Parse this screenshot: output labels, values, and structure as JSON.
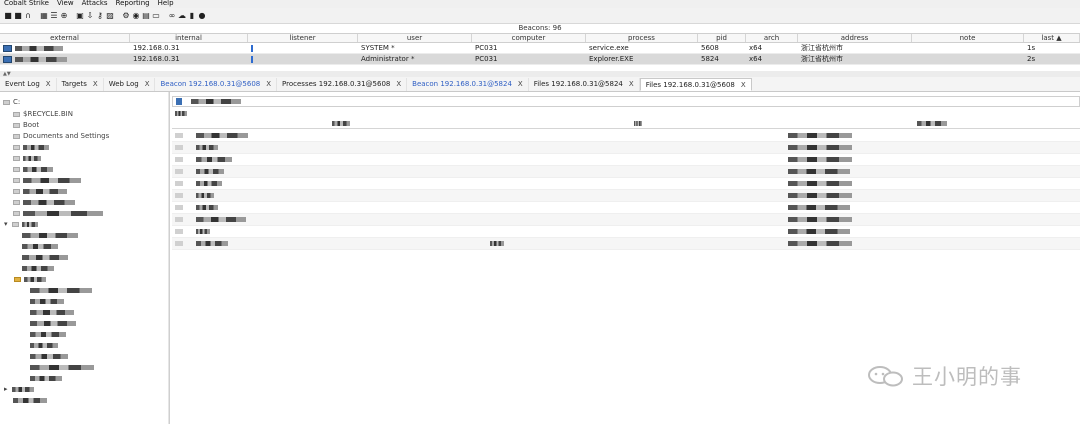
{
  "menu": [
    "Cobalt Strike",
    "View",
    "Attacks",
    "Reporting",
    "Help"
  ],
  "toolbar_icons": [
    "connect-icon",
    "disconnect-icon",
    "headset-icon",
    "listeners-icon",
    "sessions-icon",
    "target-icon",
    "credentials-icon",
    "download-icon",
    "key-icon",
    "image-icon",
    "gear-icon",
    "coffee-icon",
    "document-icon",
    "terminal-icon",
    "link-icon",
    "cloud-icon",
    "book-icon",
    "cube-icon"
  ],
  "beacon_panel": {
    "title": "Beacons: 96",
    "columns": [
      "external",
      "internal",
      "listener",
      "user",
      "computer",
      "process",
      "pid",
      "arch",
      "address",
      "note",
      "last ▲"
    ],
    "rows": [
      {
        "internal": "192.168.0.31",
        "user": "SYSTEM *",
        "computer": "PC031",
        "process": "service.exe",
        "pid": "5608",
        "arch": "x64",
        "address": "浙江省杭州市",
        "note": "",
        "last": "1s"
      },
      {
        "internal": "192.168.0.31",
        "user": "Administrator *",
        "computer": "PC031",
        "process": "Explorer.EXE",
        "pid": "5824",
        "arch": "x64",
        "address": "浙江省杭州市",
        "note": "",
        "last": "2s"
      }
    ]
  },
  "tabs": [
    {
      "label": "Event Log",
      "close": "X"
    },
    {
      "label": "Targets",
      "close": "X"
    },
    {
      "label": "Web Log",
      "close": "X"
    },
    {
      "label": "Beacon 192.168.0.31@5608",
      "close": "X"
    },
    {
      "label": "Processes 192.168.0.31@5608",
      "close": "X"
    },
    {
      "label": "Beacon 192.168.0.31@5824",
      "close": "X"
    },
    {
      "label": "Files 192.168.0.31@5824",
      "close": "X"
    },
    {
      "label": "Files 192.168.0.31@5608",
      "close": "X"
    }
  ],
  "tree": {
    "root": "C:",
    "items": [
      "$RECYCLE.BIN",
      "Boot",
      "Documents and Settings"
    ]
  },
  "watermark": "王小明的事"
}
